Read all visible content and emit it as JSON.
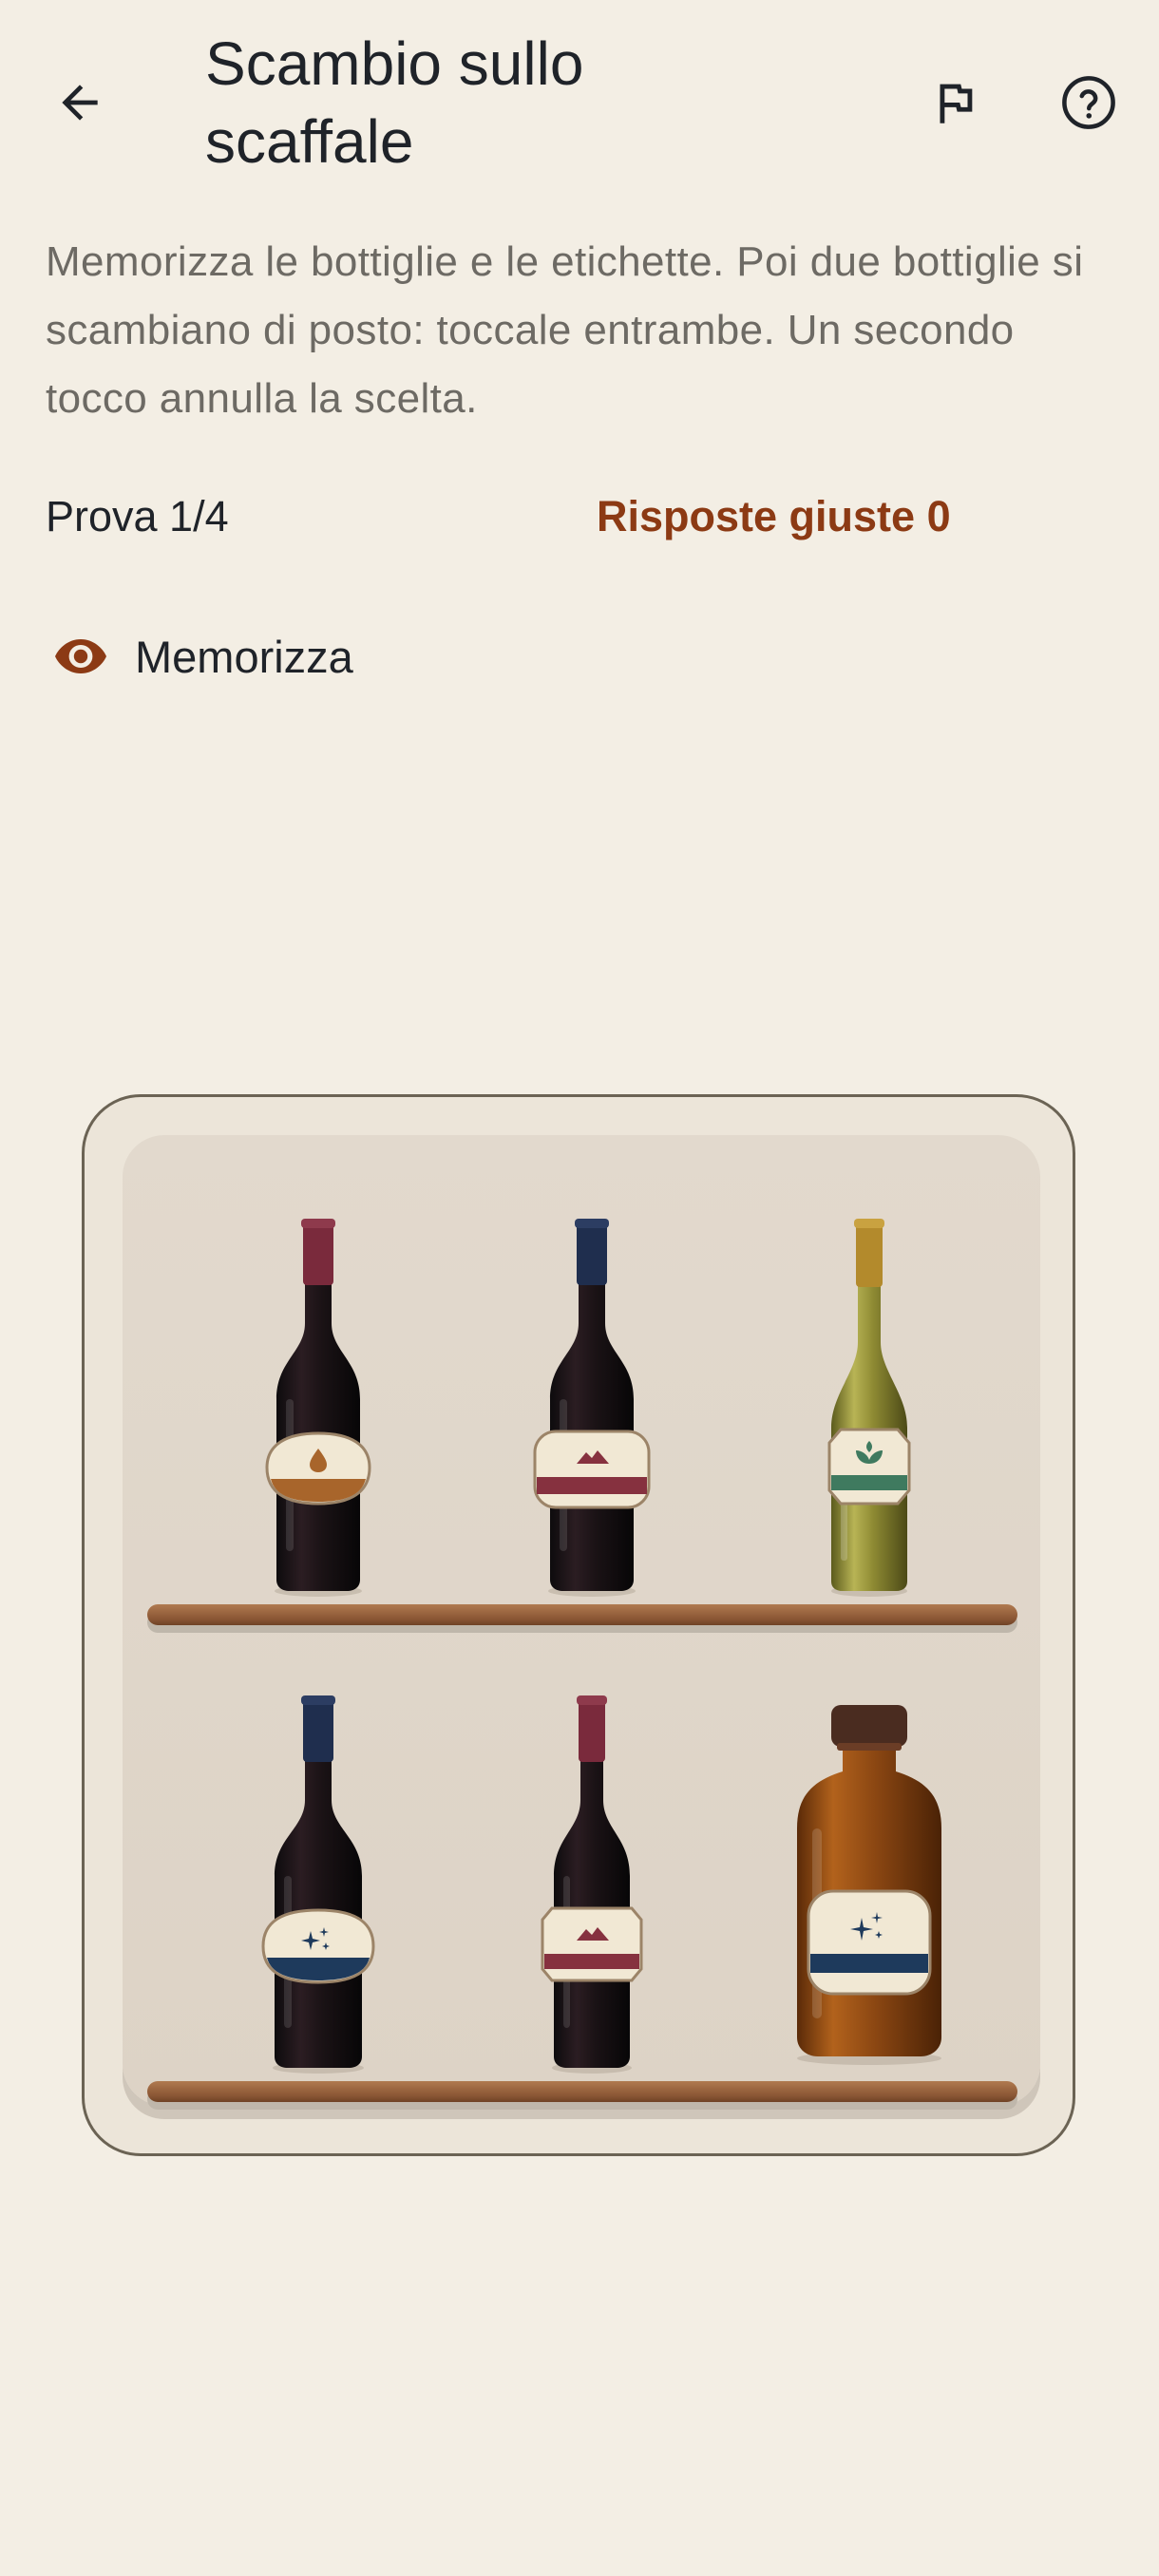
{
  "header": {
    "title": "Scambio sullo scaffale",
    "back_icon": "arrow-left-icon",
    "report_icon": "flag-icon",
    "help_icon": "help-circle-icon"
  },
  "instructions": "Memorizza le bottiglie e le etichette. Poi due bottiglie si scambiano di posto: toccale entrambe. Un secondo tocco annulla la scelta.",
  "status": {
    "attempt": "Prova 1/4",
    "score": "Risposte giuste 0"
  },
  "phase": {
    "icon": "eye-icon",
    "label": "Memorizza"
  },
  "colors": {
    "background": "#f3eee4",
    "accent": "#8c3a14",
    "text": "#1f2329",
    "muted_text": "#6d6a64"
  },
  "shelf": {
    "rows": [
      [
        {
          "type": "red-wine-bottle",
          "capsule": "burgundy",
          "label_symbol": "drop",
          "label_band": "ochre"
        },
        {
          "type": "red-wine-bottle",
          "capsule": "navy",
          "label_symbol": "mountains",
          "label_band": "burgundy"
        },
        {
          "type": "white-wine-bottle",
          "capsule": "gold",
          "label_symbol": "leaf",
          "label_band": "green"
        }
      ],
      [
        {
          "type": "red-wine-bottle",
          "capsule": "navy",
          "label_symbol": "sparkles",
          "label_band": "navy"
        },
        {
          "type": "red-wine-bottle",
          "capsule": "burgundy",
          "label_symbol": "mountains",
          "label_band": "burgundy"
        },
        {
          "type": "spirits-bottle",
          "capsule": "brown-cork",
          "label_symbol": "sparkles",
          "label_band": "navy"
        }
      ]
    ]
  }
}
